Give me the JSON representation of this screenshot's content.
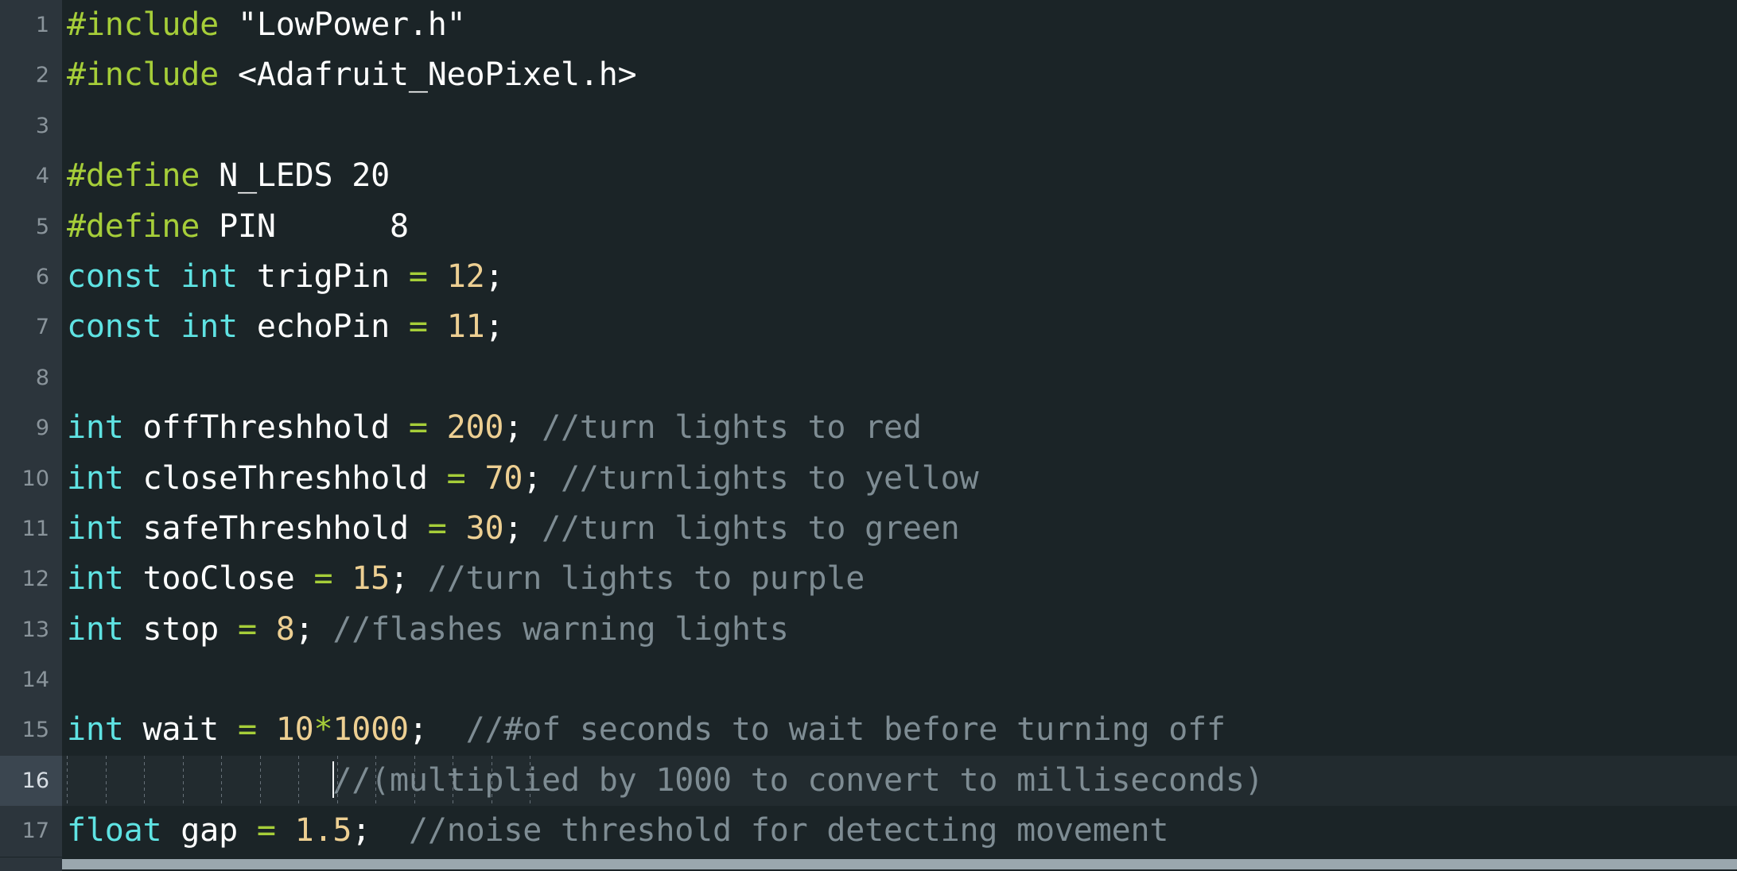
{
  "editor": {
    "name": "code-editor",
    "language": "arduino-cpp",
    "colors": {
      "background": "#1B2427",
      "gutter_background": "#2C353C",
      "gutter_foreground": "#8A949B",
      "active_line_background": "#222B2F",
      "active_gutter_background": "#3B4650",
      "preprocessor": "#A6CE39",
      "keyword": "#5FE3E3",
      "identifier": "#FFFFFF",
      "number": "#EDCF92",
      "operator": "#A6CE39",
      "comment": "#7E8C93",
      "caret": "#F2F4F5",
      "scrollbar_thumb": "#9AA7AE"
    },
    "caret": {
      "line": 16,
      "visible": true
    },
    "scrollbar": {
      "orientation": "horizontal",
      "thumb_label": "h-scroll-thumb"
    }
  },
  "lines": [
    {
      "number": "1",
      "active": false,
      "tokens": [
        {
          "t": "pre",
          "s": "#include"
        },
        {
          "t": "id",
          "s": " "
        },
        {
          "t": "str",
          "s": "\"LowPower.h\""
        }
      ]
    },
    {
      "number": "2",
      "active": false,
      "tokens": [
        {
          "t": "pre",
          "s": "#include"
        },
        {
          "t": "id",
          "s": " "
        },
        {
          "t": "str",
          "s": "<Adafruit_NeoPixel.h>"
        }
      ]
    },
    {
      "number": "3",
      "active": false,
      "tokens": []
    },
    {
      "number": "4",
      "active": false,
      "tokens": [
        {
          "t": "pre",
          "s": "#define"
        },
        {
          "t": "id",
          "s": " N_LEDS 20"
        }
      ]
    },
    {
      "number": "5",
      "active": false,
      "tokens": [
        {
          "t": "pre",
          "s": "#define"
        },
        {
          "t": "id",
          "s": " PIN      8"
        }
      ]
    },
    {
      "number": "6",
      "active": false,
      "tokens": [
        {
          "t": "kw",
          "s": "const int"
        },
        {
          "t": "id",
          "s": " trigPin "
        },
        {
          "t": "op",
          "s": "="
        },
        {
          "t": "id",
          "s": " "
        },
        {
          "t": "num",
          "s": "12"
        },
        {
          "t": "punc",
          "s": ";"
        }
      ]
    },
    {
      "number": "7",
      "active": false,
      "tokens": [
        {
          "t": "kw",
          "s": "const int"
        },
        {
          "t": "id",
          "s": " echoPin "
        },
        {
          "t": "op",
          "s": "="
        },
        {
          "t": "id",
          "s": " "
        },
        {
          "t": "num",
          "s": "11"
        },
        {
          "t": "punc",
          "s": ";"
        }
      ]
    },
    {
      "number": "8",
      "active": false,
      "tokens": []
    },
    {
      "number": "9",
      "active": false,
      "tokens": [
        {
          "t": "kw",
          "s": "int"
        },
        {
          "t": "id",
          "s": " offThreshhold "
        },
        {
          "t": "op",
          "s": "="
        },
        {
          "t": "id",
          "s": " "
        },
        {
          "t": "num",
          "s": "200"
        },
        {
          "t": "punc",
          "s": ";"
        },
        {
          "t": "id",
          "s": " "
        },
        {
          "t": "com",
          "s": "//turn lights to red"
        }
      ]
    },
    {
      "number": "10",
      "active": false,
      "tokens": [
        {
          "t": "kw",
          "s": "int"
        },
        {
          "t": "id",
          "s": " closeThreshhold "
        },
        {
          "t": "op",
          "s": "="
        },
        {
          "t": "id",
          "s": " "
        },
        {
          "t": "num",
          "s": "70"
        },
        {
          "t": "punc",
          "s": ";"
        },
        {
          "t": "id",
          "s": " "
        },
        {
          "t": "com",
          "s": "//turnlights to yellow"
        }
      ]
    },
    {
      "number": "11",
      "active": false,
      "tokens": [
        {
          "t": "kw",
          "s": "int"
        },
        {
          "t": "id",
          "s": " safeThreshhold "
        },
        {
          "t": "op",
          "s": "="
        },
        {
          "t": "id",
          "s": " "
        },
        {
          "t": "num",
          "s": "30"
        },
        {
          "t": "punc",
          "s": ";"
        },
        {
          "t": "id",
          "s": " "
        },
        {
          "t": "com",
          "s": "//turn lights to green"
        }
      ]
    },
    {
      "number": "12",
      "active": false,
      "tokens": [
        {
          "t": "kw",
          "s": "int"
        },
        {
          "t": "id",
          "s": " tooClose "
        },
        {
          "t": "op",
          "s": "="
        },
        {
          "t": "id",
          "s": " "
        },
        {
          "t": "num",
          "s": "15"
        },
        {
          "t": "punc",
          "s": ";"
        },
        {
          "t": "id",
          "s": " "
        },
        {
          "t": "com",
          "s": "//turn lights to purple"
        }
      ]
    },
    {
      "number": "13",
      "active": false,
      "tokens": [
        {
          "t": "kw",
          "s": "int"
        },
        {
          "t": "id",
          "s": " stop "
        },
        {
          "t": "op",
          "s": "="
        },
        {
          "t": "id",
          "s": " "
        },
        {
          "t": "num",
          "s": "8"
        },
        {
          "t": "punc",
          "s": ";"
        },
        {
          "t": "id",
          "s": " "
        },
        {
          "t": "com",
          "s": "//flashes warning lights"
        }
      ]
    },
    {
      "number": "14",
      "active": false,
      "tokens": []
    },
    {
      "number": "15",
      "active": false,
      "tokens": [
        {
          "t": "kw",
          "s": "int"
        },
        {
          "t": "id",
          "s": " wait "
        },
        {
          "t": "op",
          "s": "="
        },
        {
          "t": "id",
          "s": " "
        },
        {
          "t": "num",
          "s": "10"
        },
        {
          "t": "op",
          "s": "*"
        },
        {
          "t": "num",
          "s": "1000"
        },
        {
          "t": "punc",
          "s": ";"
        },
        {
          "t": "id",
          "s": "  "
        },
        {
          "t": "com",
          "s": "//#of seconds to wait before turning off"
        }
      ]
    },
    {
      "number": "16",
      "active": true,
      "indent_guides": 13,
      "caret": true,
      "tokens": [
        {
          "t": "com",
          "s": "//(multiplied by 1000 to convert to milliseconds)"
        }
      ]
    },
    {
      "number": "17",
      "active": false,
      "tokens": [
        {
          "t": "kw",
          "s": "float"
        },
        {
          "t": "id",
          "s": " gap "
        },
        {
          "t": "op",
          "s": "="
        },
        {
          "t": "id",
          "s": " "
        },
        {
          "t": "num",
          "s": "1.5"
        },
        {
          "t": "punc",
          "s": ";"
        },
        {
          "t": "id",
          "s": "  "
        },
        {
          "t": "com",
          "s": "//noise threshold for detecting movement"
        }
      ]
    }
  ]
}
